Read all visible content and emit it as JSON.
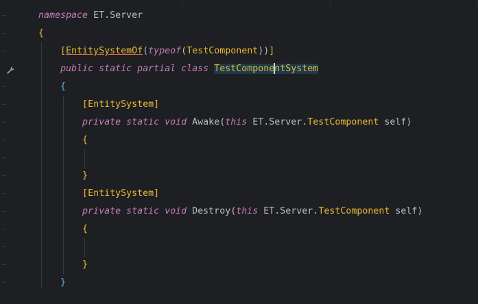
{
  "code": {
    "lines": [
      {
        "id": "l1",
        "tokens": [
          {
            "t": "namespace",
            "c": "kw2"
          },
          {
            "t": " ET.Server",
            "c": "plain"
          }
        ]
      },
      {
        "id": "l2",
        "tokens": [
          {
            "t": "{",
            "c": "brace-a"
          }
        ]
      },
      {
        "id": "l3",
        "tokens": [
          {
            "t": "    [",
            "c": "attr"
          },
          {
            "t": "EntitySystemOf",
            "c": "attr-u"
          },
          {
            "t": "(",
            "c": "plain"
          },
          {
            "t": "typeof",
            "c": "kw2"
          },
          {
            "t": "(",
            "c": "plain"
          },
          {
            "t": "TestComponent",
            "c": "type"
          },
          {
            "t": "))",
            "c": "plain"
          },
          {
            "t": "]",
            "c": "attr"
          }
        ]
      },
      {
        "id": "l4",
        "tokens": [
          {
            "t": "    ",
            "c": "plain"
          },
          {
            "t": "public static partial class",
            "c": "kw2"
          },
          {
            "t": " ",
            "c": "plain"
          },
          {
            "t": "TestComponentSystem",
            "c": "hl-word"
          }
        ]
      },
      {
        "id": "l5",
        "tokens": [
          {
            "t": "    {",
            "c": "brace-b"
          }
        ]
      },
      {
        "id": "l6",
        "tokens": [
          {
            "t": "        [",
            "c": "attr"
          },
          {
            "t": "EntitySystem",
            "c": "attr"
          },
          {
            "t": "]",
            "c": "attr"
          }
        ]
      },
      {
        "id": "l7",
        "tokens": [
          {
            "t": "        ",
            "c": "plain"
          },
          {
            "t": "private static void",
            "c": "kw2"
          },
          {
            "t": " Awake(",
            "c": "plain"
          },
          {
            "t": "this",
            "c": "kw2"
          },
          {
            "t": " ET.Server.",
            "c": "plain"
          },
          {
            "t": "TestComponent",
            "c": "type"
          },
          {
            "t": " self)",
            "c": "plain"
          }
        ]
      },
      {
        "id": "l8",
        "tokens": [
          {
            "t": "        {",
            "c": "brace-a"
          }
        ]
      },
      {
        "id": "l9",
        "tokens": []
      },
      {
        "id": "l10",
        "tokens": [
          {
            "t": "        }",
            "c": "brace-a"
          }
        ]
      },
      {
        "id": "l11",
        "tokens": [
          {
            "t": "        [",
            "c": "attr"
          },
          {
            "t": "EntitySystem",
            "c": "attr"
          },
          {
            "t": "]",
            "c": "attr"
          }
        ]
      },
      {
        "id": "l12",
        "tokens": [
          {
            "t": "        ",
            "c": "plain"
          },
          {
            "t": "private static void",
            "c": "kw2"
          },
          {
            "t": " Destroy(",
            "c": "plain"
          },
          {
            "t": "this",
            "c": "kw2"
          },
          {
            "t": " ET.Server.",
            "c": "plain"
          },
          {
            "t": "TestComponent",
            "c": "type"
          },
          {
            "t": " self)",
            "c": "plain"
          }
        ]
      },
      {
        "id": "l13",
        "tokens": [
          {
            "t": "        {",
            "c": "brace-a"
          }
        ]
      },
      {
        "id": "l14",
        "tokens": []
      },
      {
        "id": "l15",
        "tokens": [
          {
            "t": "        }",
            "c": "brace-a"
          }
        ]
      },
      {
        "id": "l16",
        "tokens": [
          {
            "t": "    }",
            "c": "brace-b"
          }
        ]
      }
    ]
  },
  "gutter": {
    "intention_icon": "wrench-icon"
  },
  "colors": {
    "background": "#1e1f22",
    "keyword": "#c77dbb",
    "type": "#e8ba36",
    "text": "#bcbec4",
    "highlight": "#1b3a4a"
  }
}
